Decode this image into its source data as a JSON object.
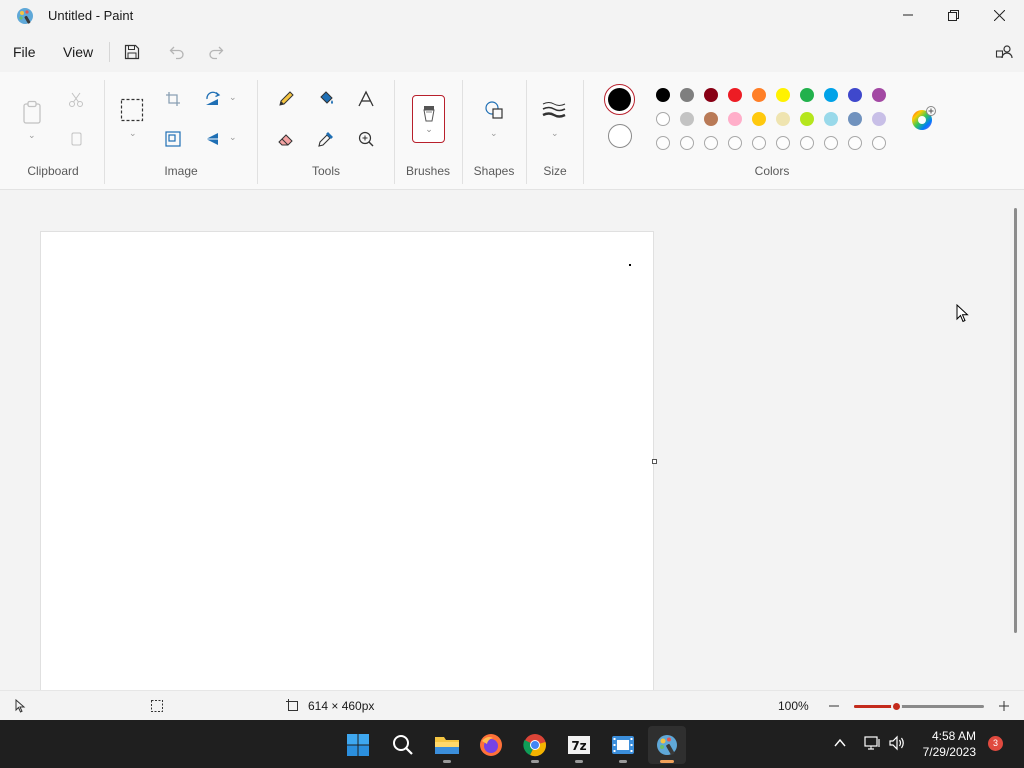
{
  "window": {
    "title": "Untitled - Paint"
  },
  "menu": {
    "file": "File",
    "view": "View"
  },
  "ribbon": {
    "groups": {
      "clipboard": "Clipboard",
      "image": "Image",
      "tools": "Tools",
      "brushes": "Brushes",
      "shapes": "Shapes",
      "size": "Size",
      "colors": "Colors"
    },
    "colors": {
      "primary": "#000000",
      "secondary": "#ffffff",
      "row1": [
        "#000000",
        "#7f7f7f",
        "#880015",
        "#ed1c24",
        "#ff7f27",
        "#fff200",
        "#22b14c",
        "#00a2e8",
        "#3f48cc",
        "#a349a4"
      ],
      "row2": [
        "#ffffff",
        "#c3c3c3",
        "#b97a57",
        "#ffaec9",
        "#ffc90e",
        "#efe4b0",
        "#b5e61d",
        "#99d9ea",
        "#7092be",
        "#c8bfe7"
      ]
    }
  },
  "status": {
    "canvas_size": "614 × 460px",
    "zoom": "100%",
    "zoom_fraction": 0.32
  },
  "taskbar": {
    "time": "4:58 AM",
    "date": "7/29/2023",
    "notifications": "3",
    "apps": [
      "start",
      "search",
      "file-explorer",
      "firefox",
      "chrome",
      "7-zip",
      "video-editor",
      "paint"
    ]
  }
}
